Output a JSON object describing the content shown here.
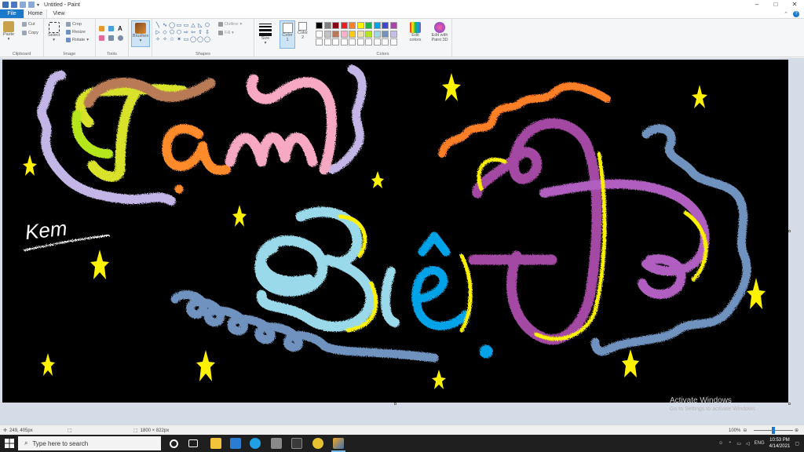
{
  "window": {
    "title": "Untitled - Paint",
    "controls": [
      "–",
      "□",
      "✕"
    ]
  },
  "tabs": {
    "file": "File",
    "home": "Home",
    "view": "View"
  },
  "ribbon": {
    "clipboard": {
      "paste": "Paste",
      "cut": "Cut",
      "copy": "Copy",
      "label": "Clipboard"
    },
    "image": {
      "select": "Select",
      "crop": "Crop",
      "resize": "Resize",
      "rotate": "Rotate",
      "label": "Image"
    },
    "tools": {
      "label": "Tools",
      "text_tool": "A"
    },
    "brushes": {
      "label": "Brushes"
    },
    "shapes": {
      "label": "Shapes",
      "outline": "Outline",
      "fill": "Fill",
      "glyphs": [
        "╲",
        "∿",
        "◯",
        "▭",
        "▭",
        "△",
        "◺",
        "⬠",
        "▷",
        "◇",
        "⬠",
        "⬡",
        "⇨",
        "⇦",
        "⇧",
        "⇩",
        "✧",
        "✧",
        "☆",
        "✶",
        "▭",
        "◯",
        "◯",
        "◯"
      ]
    },
    "size": {
      "label": "Size"
    },
    "color1": {
      "label": "Color",
      "num": "1"
    },
    "color2": {
      "label": "Color",
      "num": "2"
    },
    "colors": {
      "label": "Colors",
      "row1": [
        "#000000",
        "#7f7f7f",
        "#880015",
        "#ed1c24",
        "#ff7f27",
        "#fff200",
        "#22b14c",
        "#00a2e8",
        "#3f48cc",
        "#a349a4"
      ],
      "row2": [
        "#ffffff",
        "#c3c3c3",
        "#b97a57",
        "#ffaec9",
        "#ffc90e",
        "#efe4b0",
        "#b5e61d",
        "#99d9ea",
        "#7092be",
        "#c8bfe7"
      ],
      "row3": [
        "#ffffff",
        "#ffffff",
        "#ffffff",
        "#ffffff",
        "#ffffff",
        "#ffffff",
        "#ffffff",
        "#ffffff",
        "#ffffff",
        "#ffffff"
      ]
    },
    "edit_colors": "Edit colors",
    "edit_with_paint3d": "Edit with Paint 3D"
  },
  "canvas": {
    "signature": "Kem"
  },
  "watermark": {
    "line1": "Activate Windows",
    "line2": "Go to Settings to activate Windows."
  },
  "status": {
    "cursor": "249, 405px",
    "size": "1800 × 822px",
    "zoom": "100%"
  },
  "taskbar": {
    "search_placeholder": "Type here to search",
    "time": "10:53 PM",
    "date": "4/14/2021",
    "lang": "ENG"
  }
}
